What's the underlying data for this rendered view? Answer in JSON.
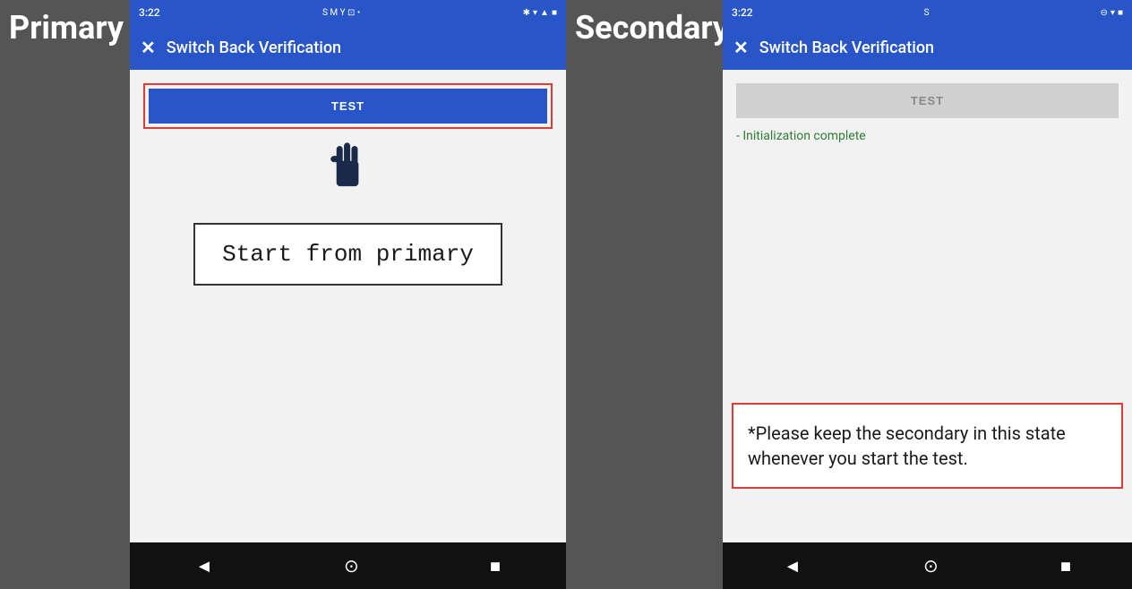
{
  "left": {
    "label": "Primary",
    "status_bar": {
      "time": "3:22",
      "icons_left": "S M Y ⊡ •",
      "icons_right": "✱ ▾ ▲ ■"
    },
    "app_bar": {
      "close": "✕",
      "title": "Switch Back Verification"
    },
    "test_button": "TEST",
    "start_box_text": "Start from primary",
    "nav": {
      "back": "◄",
      "home": "⊙",
      "recent": "■"
    }
  },
  "right": {
    "label": "Secondary",
    "status_bar": {
      "time": "3:22",
      "icons_left": "S",
      "icons_right": "⊖ ▾ ■"
    },
    "app_bar": {
      "close": "✕",
      "title": "Switch Back Verification"
    },
    "test_button": "TEST",
    "init_text": "- Initialization complete",
    "notice": "*Please keep the secondary in this state whenever you start the test.",
    "nav": {
      "back": "◄",
      "home": "⊙",
      "recent": "■"
    }
  }
}
